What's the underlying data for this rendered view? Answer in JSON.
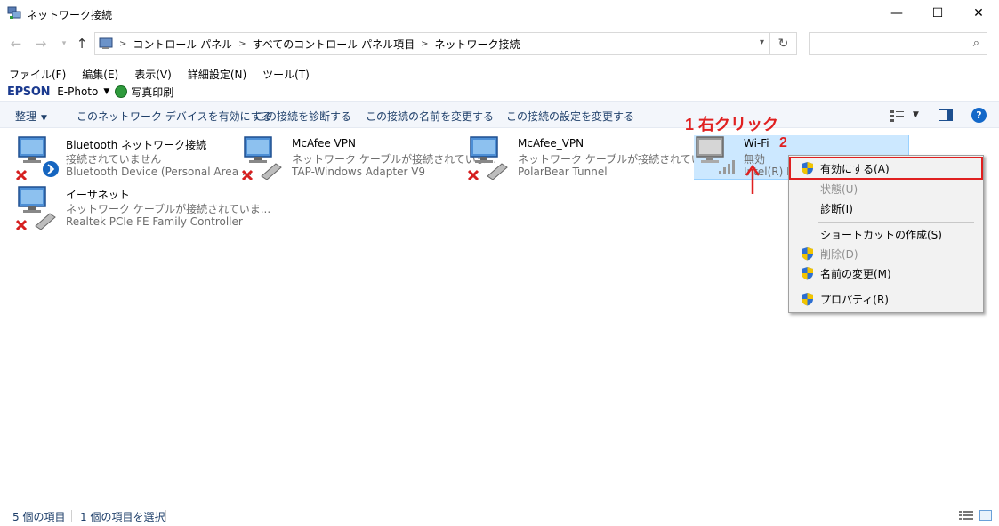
{
  "window": {
    "title": "ネットワーク接続",
    "minimize": "—",
    "maximize": "☐",
    "close": "✕"
  },
  "address": {
    "crumbs": [
      "コントロール パネル",
      "すべてのコントロール パネル項目",
      "ネットワーク接続"
    ],
    "search_placeholder": ""
  },
  "menu": [
    "ファイル(F)",
    "編集(E)",
    "表示(V)",
    "詳細設定(N)",
    "ツール(T)"
  ],
  "epson": {
    "logo": "EPSON",
    "ephoto": "E-Photo",
    "photo_print": "写真印刷"
  },
  "commands": {
    "organize": "整理",
    "enable_device": "このネットワーク デバイスを有効にする",
    "diagnose": "この接続を診断する",
    "rename": "この接続の名前を変更する",
    "settings": "この接続の設定を変更する"
  },
  "connections": [
    {
      "name": "Bluetooth ネットワーク接続",
      "status": "接続されていません",
      "device": "Bluetooth Device (Personal Area ...",
      "type": "bluetooth"
    },
    {
      "name": "McAfee VPN",
      "status": "ネットワーク ケーブルが接続されていま...",
      "device": "TAP-Windows Adapter V9",
      "type": "ethernet"
    },
    {
      "name": "McAfee_VPN",
      "status": "ネットワーク ケーブルが接続されていま...",
      "device": "PolarBear Tunnel",
      "type": "ethernet"
    },
    {
      "name": "Wi-Fi",
      "status": "無効",
      "device": "Intel(R) Du",
      "type": "wifi"
    },
    {
      "name": "イーサネット",
      "status": "ネットワーク ケーブルが接続されていま...",
      "device": "Realtek PCIe FE Family Controller",
      "type": "ethernet"
    }
  ],
  "annotations": {
    "step1": "1 右クリック",
    "step2": "2"
  },
  "context_menu": [
    {
      "label": "有効にする(A)",
      "shield": true,
      "disabled": false,
      "highlighted": true
    },
    {
      "label": "状態(U)",
      "shield": false,
      "disabled": true
    },
    {
      "label": "診断(I)",
      "shield": false,
      "disabled": false
    },
    {
      "label": "ショートカットの作成(S)",
      "shield": false,
      "disabled": false
    },
    {
      "label": "削除(D)",
      "shield": true,
      "disabled": true
    },
    {
      "label": "名前の変更(M)",
      "shield": true,
      "disabled": false
    },
    {
      "label": "プロパティ(R)",
      "shield": true,
      "disabled": false
    }
  ],
  "statusbar": {
    "count": "5 個の項目",
    "selected": "1 個の項目を選択"
  },
  "colors": {
    "accent_red": "#e02020",
    "selection": "#cce8ff",
    "link_blue": "#1e3f6a"
  }
}
